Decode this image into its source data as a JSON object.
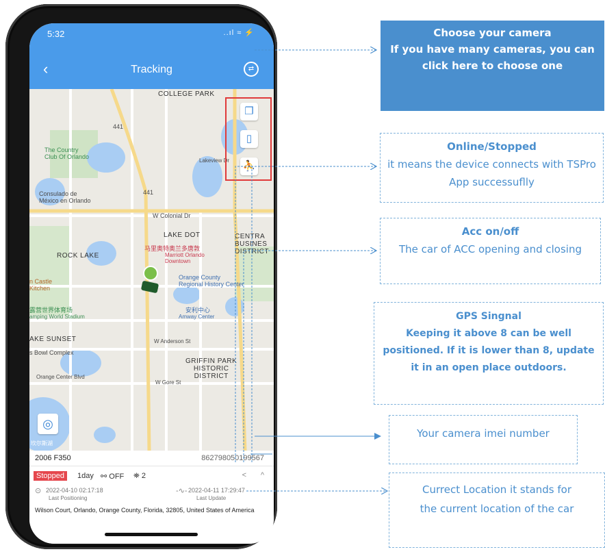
{
  "status_bar": {
    "time": "5:32",
    "signal_text": "..ıl ≈ ⚡"
  },
  "nav": {
    "back_label": "‹",
    "title": "Tracking",
    "switch_icon": "⇄"
  },
  "map": {
    "labels": {
      "college_park": "COLLEGE PARK",
      "hwy_441_a": "441",
      "hwy_441_b": "441",
      "country_club": "The Country\nClub Of Orlando",
      "lakeview": "Lakeview Dr",
      "consulado": "Consulado de\nMéxico en Orlando",
      "colonial": "W Colonial Dr",
      "lake_dot": "LAKE DOT",
      "central": "CENTRA\nBUSINES\nDISTRICT",
      "marriott_cn": "马里奥特奥兰多唐敦",
      "marriott": "Marriott Orlando\nDowntown",
      "rock_lake": "ROCK LAKE",
      "castle": "n Castle\nKitchen",
      "history": "Orange County\nRegional History Center",
      "camping_cn": "露营世界体育场",
      "camping": "amping World Stadium",
      "amway_cn": "安利中心",
      "amway": "Amway Center",
      "sunset": "AKE SUNSET",
      "anderson": "W Anderson St",
      "bowl": "s Bowl Complex",
      "griffin": "GRIFFIN PARK\nHISTORIC\nDISTRICT",
      "orange_center": "Orange Center Blvd",
      "gore": "W Gore St",
      "lake_cn": "坎尔斯湖"
    },
    "tools": {
      "layers_icon": "❐",
      "device_icon": "▯",
      "person_icon": "⛹"
    },
    "locate_icon": "◎"
  },
  "device": {
    "name": "2006 F350",
    "imei": "862798050199567",
    "status": "Stopped",
    "duration": "1day",
    "acc": "⚯ OFF",
    "gps": "⛯ 2",
    "share_icon": "<",
    "collapse_icon": "^",
    "last_positioning_icon": "⊙",
    "last_positioning_time": "2022-04-10 02:17:18",
    "last_positioning_label": "Last Positioning",
    "last_update_icon": "-∿-",
    "last_update_time": "2022-04-11 17:29:47",
    "last_update_label": "Last Update",
    "address": "Wilson Court, Orlando, Orange County, Florida, 32805, United States of America"
  },
  "annotations": [
    {
      "title": "Choose your camera",
      "body": "If you have many cameras, you can click here to choose one"
    },
    {
      "title": "Online/Stopped",
      "body": "it means the device connects with TSPro App successuflly"
    },
    {
      "title": "Acc on/off",
      "body": "The car of ACC opening and closing"
    },
    {
      "title": "GPS Singnal",
      "body": "Keeping it above 8 can be well positioned. If it is lower than 8, update it in an open place outdoors."
    },
    {
      "title": "",
      "body": "Your camera imei number"
    },
    {
      "title": "",
      "body": "Currect Location it stands for the current location of the car"
    }
  ],
  "colors": {
    "brand": "#4a9bea",
    "callout": "#4a8fce",
    "stopped": "#e5474d",
    "highlight": "#e03a3a"
  }
}
